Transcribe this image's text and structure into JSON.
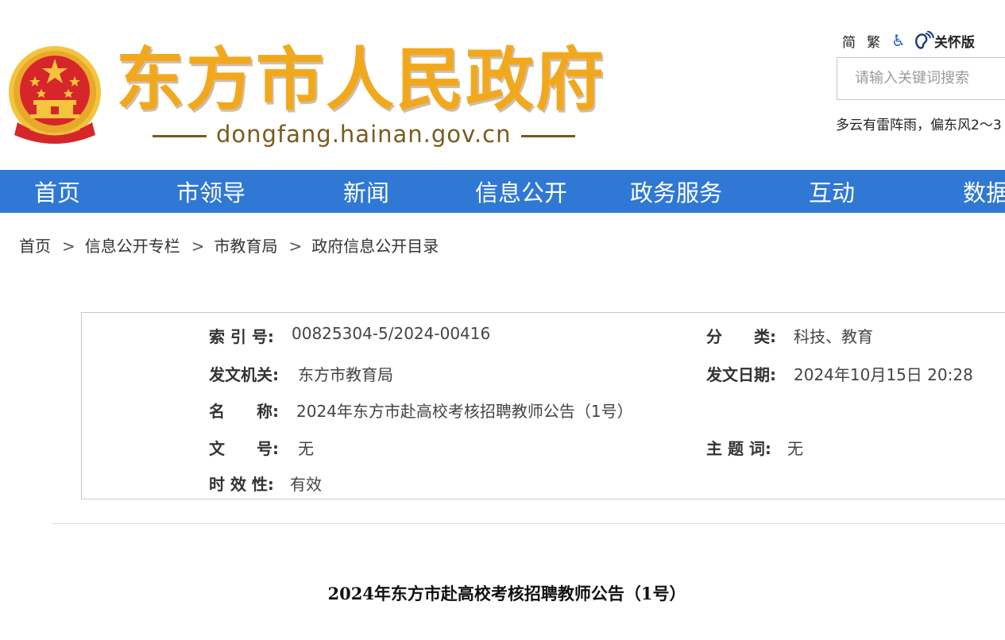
{
  "header": {
    "site_title": "东方市人民政府",
    "site_domain": "dongfang.hainan.gov.cn",
    "tools": {
      "simplified": "简",
      "traditional": "繁",
      "care_mode": "关怀版"
    },
    "search": {
      "placeholder": "请输入关键词搜索"
    },
    "weather": "多云有雷阵雨，偏东风2～3"
  },
  "nav": {
    "items": [
      {
        "label": "首页"
      },
      {
        "label": "市领导"
      },
      {
        "label": "新闻"
      },
      {
        "label": "信息公开"
      },
      {
        "label": "政务服务"
      },
      {
        "label": "互动"
      },
      {
        "label": "数据"
      }
    ]
  },
  "breadcrumb": {
    "items": [
      {
        "label": "首页"
      },
      {
        "label": "信息公开专栏"
      },
      {
        "label": "市教育局"
      },
      {
        "label": "政府信息公开目录"
      }
    ],
    "separator": ">"
  },
  "meta": {
    "index_no": {
      "label": "索 引 号:",
      "value": "00825304-5/2024-00416"
    },
    "category": {
      "label": "分　　类:",
      "value": "科技、教育"
    },
    "issuer": {
      "label": "发文机关:",
      "value": "东方市教育局"
    },
    "issue_date": {
      "label": "发文日期:",
      "value": "2024年10月15日 20:28"
    },
    "name": {
      "label": "名　　称:",
      "value": "2024年东方市赴高校考核招聘教师公告（1号）"
    },
    "doc_no": {
      "label": "文　　号:",
      "value": "无"
    },
    "subject": {
      "label": "主 题 词:",
      "value": "无"
    },
    "validity": {
      "label": "时 效 性:",
      "value": "有效"
    }
  },
  "document": {
    "title": "2024年东方市赴高校考核招聘教师公告（1号）"
  },
  "colors": {
    "nav_bg": "#2f78d4",
    "title_gold": "#f2a81d",
    "emblem_red": "#d7262a",
    "emblem_gold": "#f3c43c"
  }
}
